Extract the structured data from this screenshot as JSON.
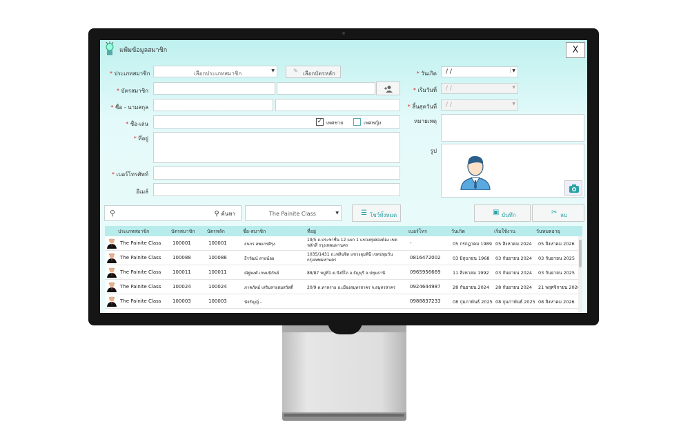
{
  "window": {
    "title": "แฟ้มข้อมูลสมาชิก",
    "close_label": "X"
  },
  "form": {
    "member_type": {
      "label": "ประเภทสมาชิก",
      "value": "เลือกประเภทสมาชิก",
      "pick_card_label": "เลือกบัตรหลัก"
    },
    "member_card": {
      "label": "บัตรสมาชิก"
    },
    "fullname": {
      "label": "ชื่อ - นามสกุล"
    },
    "nickname": {
      "label": "ชื่อ-เล่น",
      "male_label": "เพศชาย",
      "male_checked": true,
      "female_label": "เพศหญิง",
      "female_checked": false
    },
    "address": {
      "label": "ที่อยู่"
    },
    "phone": {
      "label": "เบอร์โทรศัพท์"
    },
    "email": {
      "label": "อีเมล์"
    },
    "birthday": {
      "label": "วันเกิด",
      "value": "/ /"
    },
    "start_date": {
      "label": "เริ่มวันที่",
      "value": "/ /"
    },
    "end_date": {
      "label": "สิ้นสุดวันที่",
      "value": "/ /"
    },
    "note": {
      "label": "หมายเหตุ"
    },
    "photo": {
      "label": "รูป"
    }
  },
  "toolbar": {
    "search_label": "ค้นหา",
    "class_filter": "The Painite Class",
    "show_all_label": "โชว์ทั้งหมด",
    "save_label": "บันทึก",
    "delete_label": "ลบ"
  },
  "table": {
    "columns": [
      "ประเภทสมาชิก",
      "บัตรสมาชิก",
      "บัตรหลัก",
      "ชื่อ-สมาชิก",
      "ที่อยู่",
      "เบอร์โทร",
      "วันเกิด",
      "เริ่มใช้งาน",
      "วันหมดอายุ"
    ],
    "rows": [
      [
        "The Painite Class",
        "100001",
        "100001",
        "ธนกร ลพแกรศิรุง",
        "19/5 ถ.ประชาชื่น 12 แยก 1 แขวงทุ่งสองห้อง เขต หลักสี่ กรุงเทพมหานคร",
        "-",
        "05 กรกฎาคม 1989",
        "05 สิงหาคม 2024",
        "05 สิงหาคม 2026"
      ],
      [
        "The Painite Class",
        "100088",
        "100088",
        "ธีรวัฒน์ สายน้อย",
        "1035/1431 ถ.เพลินจิต แขวงลุมพินี เขตปทุมวัน กรุงเทพมหานคร",
        "0816472002",
        "03 มิถุนายน 1968",
        "03 กันยายน 2024",
        "03 กันยายน 2025"
      ],
      [
        "The Painite Class",
        "100011",
        "100011",
        "ณัฐพงศ์ เกษมนิกันย์",
        "88/87 หมู่ที่1 ต.บึงยี่โถ อ.ธัญบุรี จ.ปทุมธานี",
        "0965956669",
        "11 สิงหาคม 1992",
        "03 กันยายน 2024",
        "03 กันยายน 2025"
      ],
      [
        "The Painite Class",
        "100024",
        "100024",
        "ภาคภัทม์ เสริมสายสมสวัสดิ์",
        "20/9 ต.ท่าทราย อ.เมืองสมุทรสาคร จ.สมุทรสาคร",
        "0924644987",
        "28 กันยายน 2024",
        "28 กันยายน 2024",
        "21 พฤศจิกายน 2026"
      ],
      [
        "The Painite Class",
        "100003",
        "100003",
        "นัจรัญญ์ -",
        "",
        "0988837233",
        "08 กุมภาพันธ์ 2025",
        "08 กุมภาพันธ์ 2025",
        "08 สิงหาคม 2026"
      ]
    ]
  },
  "colors": {
    "accent": "#2aa3a3",
    "header_bg": "#b8ecec",
    "screen_bg": "#e4fafa"
  }
}
